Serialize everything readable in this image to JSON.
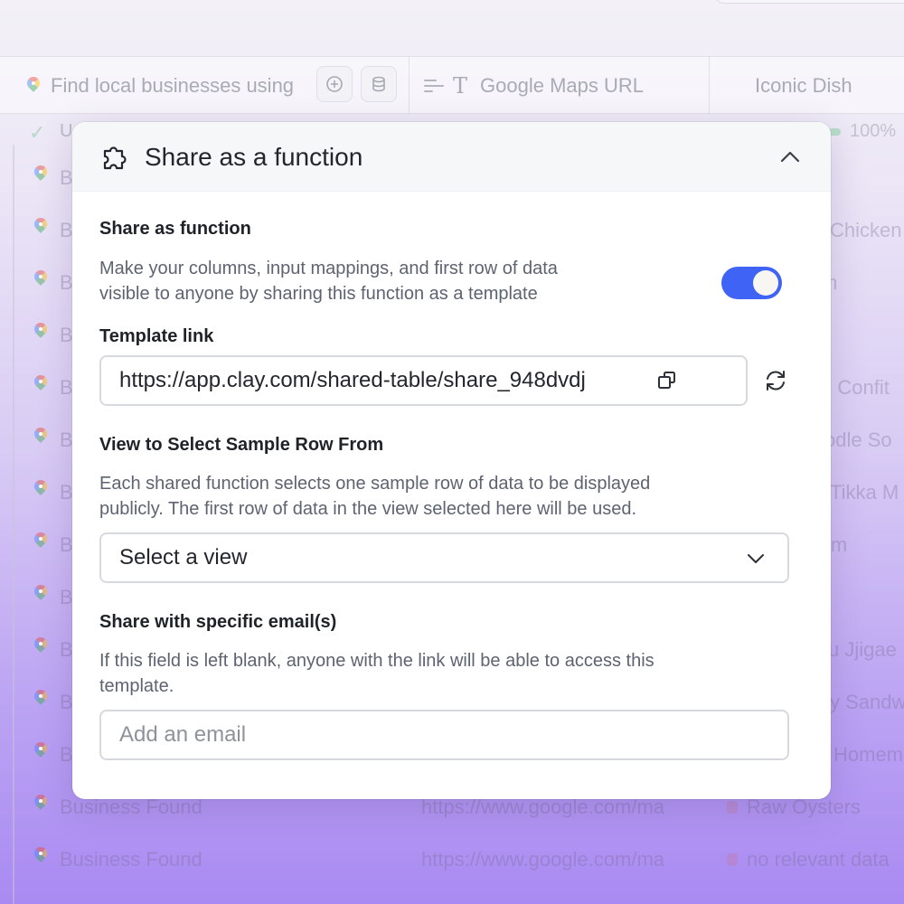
{
  "background": {
    "header": {
      "col1_label": "Find local businesses using",
      "col2_label": "Google Maps URL",
      "col3_label": "Iconic Dish",
      "col1_icons": [
        "plus-circle-icon",
        "database-icon"
      ],
      "col2_icons": [
        "lines-icon",
        "text-type-icon"
      ]
    },
    "status": {
      "letter": "U",
      "percent": "100%"
    },
    "rows": [
      {
        "c1": "B",
        "c2": "",
        "c3": ""
      },
      {
        "c1": "B",
        "c2": "",
        "c3": "Chicken"
      },
      {
        "c1": "B",
        "c2": "",
        "c3": "m"
      },
      {
        "c1": "B",
        "c2": "",
        "c3": ""
      },
      {
        "c1": "B",
        "c2": "",
        "c3": "g Confit"
      },
      {
        "c1": "B",
        "c2": "",
        "c3": "odle So"
      },
      {
        "c1": "B",
        "c2": "",
        "c3": "Tikka M"
      },
      {
        "c1": "B",
        "c2": "",
        "c3": "im"
      },
      {
        "c1": "B",
        "c2": "",
        "c3": ""
      },
      {
        "c1": "B",
        "c2": "",
        "c3": "u Jjigae"
      },
      {
        "c1": "B",
        "c2": "",
        "c3": "y Sandw"
      },
      {
        "c1": "B",
        "c2": "",
        "c3": "Homem"
      },
      {
        "c1": "Business Found",
        "c2": "https://www.google.com/ma",
        "c3": "Raw Oysters"
      },
      {
        "c1": "Business Found",
        "c2": "https://www.google.com/ma",
        "c3": "no relevant data"
      }
    ]
  },
  "modal": {
    "title": "Share as a function",
    "title_icon": "puzzle-piece-icon",
    "collapse_icon": "chevron-up-icon",
    "share_section": {
      "label": "Share as function",
      "description_line1": "Make your columns, input mappings, and first row of data",
      "description_line2": "visible to anyone by sharing this function as a template",
      "toggle_on": true,
      "toggle_color": "#3f63f5"
    },
    "template_link": {
      "label": "Template link",
      "value": "https://app.clay.com/shared-table/share_948dvdj",
      "copy_icon": "copy-icon",
      "refresh_icon": "refresh-icon"
    },
    "view_section": {
      "label": "View to Select Sample Row From",
      "description_line1": "Each shared function selects one sample row of data to be displayed",
      "description_line2": "publicly. The first row of data in the view selected here will be used.",
      "select_value": "Select a view",
      "select_icon": "chevron-down-icon"
    },
    "email_section": {
      "label": "Share with specific email(s)",
      "description_line1": "If this field is left blank, anyone with the link will be able to access this",
      "description_line2": "template.",
      "placeholder": "Add an email"
    }
  }
}
